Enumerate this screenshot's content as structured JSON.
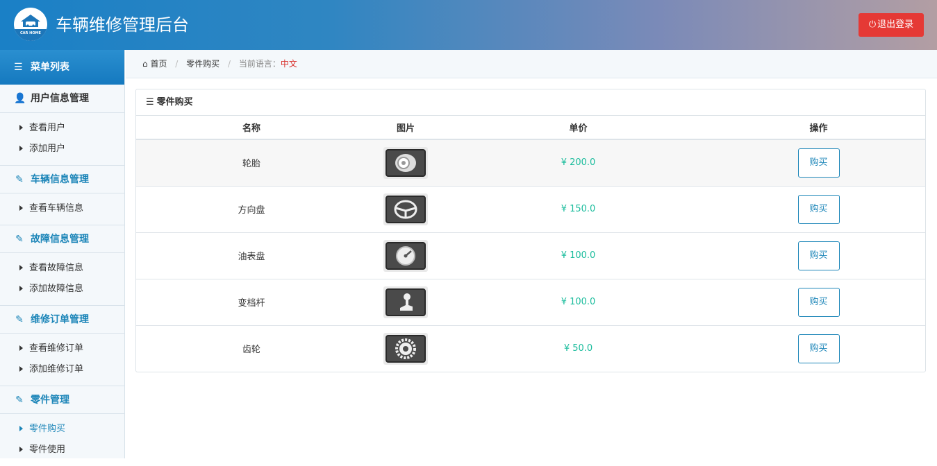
{
  "header": {
    "title": "车辆维修管理后台",
    "logo_caption": "CAR HOME",
    "logout_label": "退出登录"
  },
  "sidebar": {
    "heading": "菜单列表",
    "groups": [
      {
        "label": "用户信息管理",
        "items": [
          {
            "label": "查看用户"
          },
          {
            "label": "添加用户"
          }
        ]
      },
      {
        "label": "车辆信息管理",
        "items": [
          {
            "label": "查看车辆信息"
          }
        ]
      },
      {
        "label": "故障信息管理",
        "items": [
          {
            "label": "查看故障信息"
          },
          {
            "label": "添加故障信息"
          }
        ]
      },
      {
        "label": "维修订单管理",
        "items": [
          {
            "label": "查看维修订单"
          },
          {
            "label": "添加维修订单"
          }
        ]
      },
      {
        "label": "零件管理",
        "items": [
          {
            "label": "零件购买"
          },
          {
            "label": "零件使用"
          }
        ]
      }
    ]
  },
  "breadcrumb": {
    "home": "首页",
    "current": "零件购买",
    "lang_label": "当前语言：",
    "lang_value": "中文"
  },
  "panel": {
    "title": "零件购买",
    "columns": {
      "name": "名称",
      "image": "图片",
      "price": "单价",
      "action": "操作"
    },
    "rows": [
      {
        "name": "轮胎",
        "price": "¥ 200.0",
        "icon": "tire-icon",
        "action": "购买"
      },
      {
        "name": "方向盘",
        "price": "¥ 150.0",
        "icon": "steering-wheel-icon",
        "action": "购买"
      },
      {
        "name": "油表盘",
        "price": "¥ 100.0",
        "icon": "fuel-gauge-icon",
        "action": "购买"
      },
      {
        "name": "变档杆",
        "price": "¥ 100.0",
        "icon": "gear-shift-icon",
        "action": "购买"
      },
      {
        "name": "齿轮",
        "price": "¥ 50.0",
        "icon": "gear-icon",
        "action": "购买"
      }
    ]
  },
  "colors": {
    "accent": "#1b85b8",
    "price": "#1abc9c",
    "logout": "#e53935"
  }
}
